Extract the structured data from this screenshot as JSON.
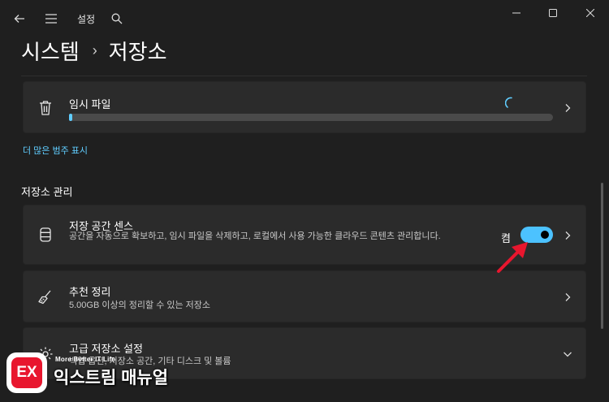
{
  "window": {
    "title": "설정",
    "controls": [
      "minimize",
      "maximize",
      "close"
    ]
  },
  "breadcrumb": {
    "parent": "시스템",
    "separator": "›",
    "current": "저장소"
  },
  "temp_files": {
    "label": "임시 파일",
    "progress_fraction": 0.005,
    "status": "loading"
  },
  "more_link": "더 많은 범주 표시",
  "section": {
    "title": "저장소 관리"
  },
  "storage_sense": {
    "title": "저장 공간 센스",
    "description": "공간을 자동으로 확보하고, 임시 파일을 삭제하고, 로컬에서 사용 가능한 클라우드 콘텐츠 관리합니다.",
    "toggle_label": "켬",
    "toggle_on": true
  },
  "cleanup": {
    "title": "추천 정리",
    "description": "5.00GB 이상의 정리할 수 있는 저장소"
  },
  "advanced": {
    "title": "고급 저장소 설정",
    "description": "백업 옵션, 저장소 공간, 기타 디스크 및 볼륨"
  },
  "watermark": {
    "logo": "EX",
    "tagline": "More Better IT Life",
    "name": "익스트림 매뉴얼"
  },
  "colors": {
    "background": "#1f1f1f",
    "card": "#2b2b2b",
    "accent": "#60cdff",
    "arrow": "#e8162e"
  }
}
